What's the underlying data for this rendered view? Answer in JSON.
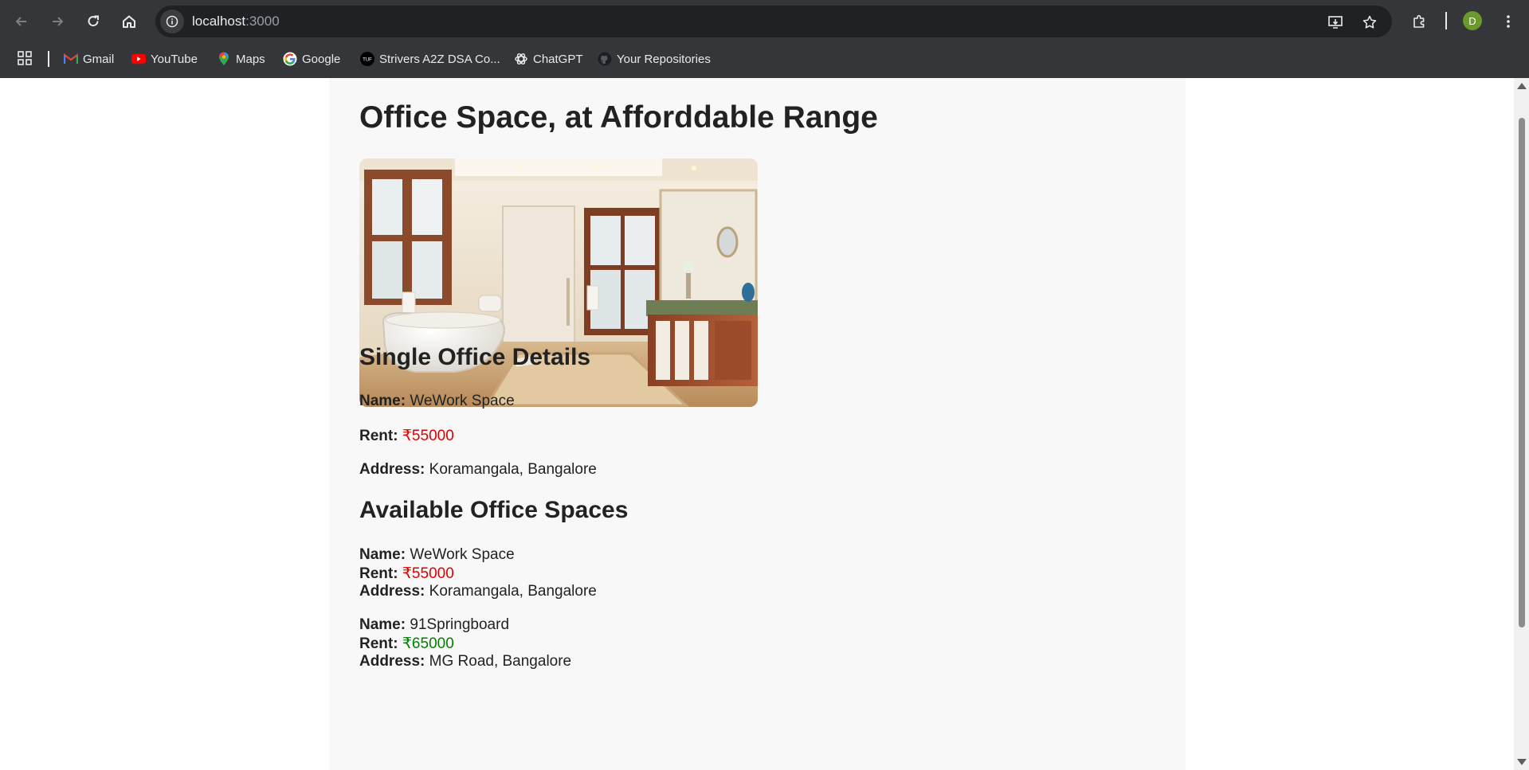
{
  "browser": {
    "url_host": "localhost",
    "url_port": ":3000",
    "profile_initial": "D",
    "bookmarks": [
      {
        "label": "Gmail",
        "icon": "gmail-icon"
      },
      {
        "label": "YouTube",
        "icon": "youtube-icon"
      },
      {
        "label": "Maps",
        "icon": "maps-icon"
      },
      {
        "label": "Google",
        "icon": "google-icon"
      },
      {
        "label": "Strivers A2Z DSA Co...",
        "icon": "tuf-icon"
      },
      {
        "label": "ChatGPT",
        "icon": "chatgpt-icon"
      },
      {
        "label": "Your Repositories",
        "icon": "github-icon"
      }
    ]
  },
  "page": {
    "title": "Office Space, at Afforddable Range",
    "single_heading": "Single Office Details",
    "labels": {
      "name": "Name:",
      "rent": "Rent:",
      "address": "Address:"
    },
    "single": {
      "name": "WeWork Space",
      "rent": "₹55000",
      "address": "Koramangala, Bangalore"
    },
    "list_heading": "Available Office Spaces",
    "offices": [
      {
        "name": "WeWork Space",
        "rent": "₹55000",
        "address": "Koramangala, Bangalore",
        "rent_color": "#e00000"
      },
      {
        "name": "91Springboard",
        "rent": "₹65000",
        "address": "MG Road, Bangalore",
        "rent_color": "#008000"
      }
    ]
  },
  "colors": {
    "rent_below_threshold": "#e00000",
    "rent_above_threshold": "#008000",
    "chrome_bg": "#35363a",
    "omnibox_bg": "#202124"
  }
}
